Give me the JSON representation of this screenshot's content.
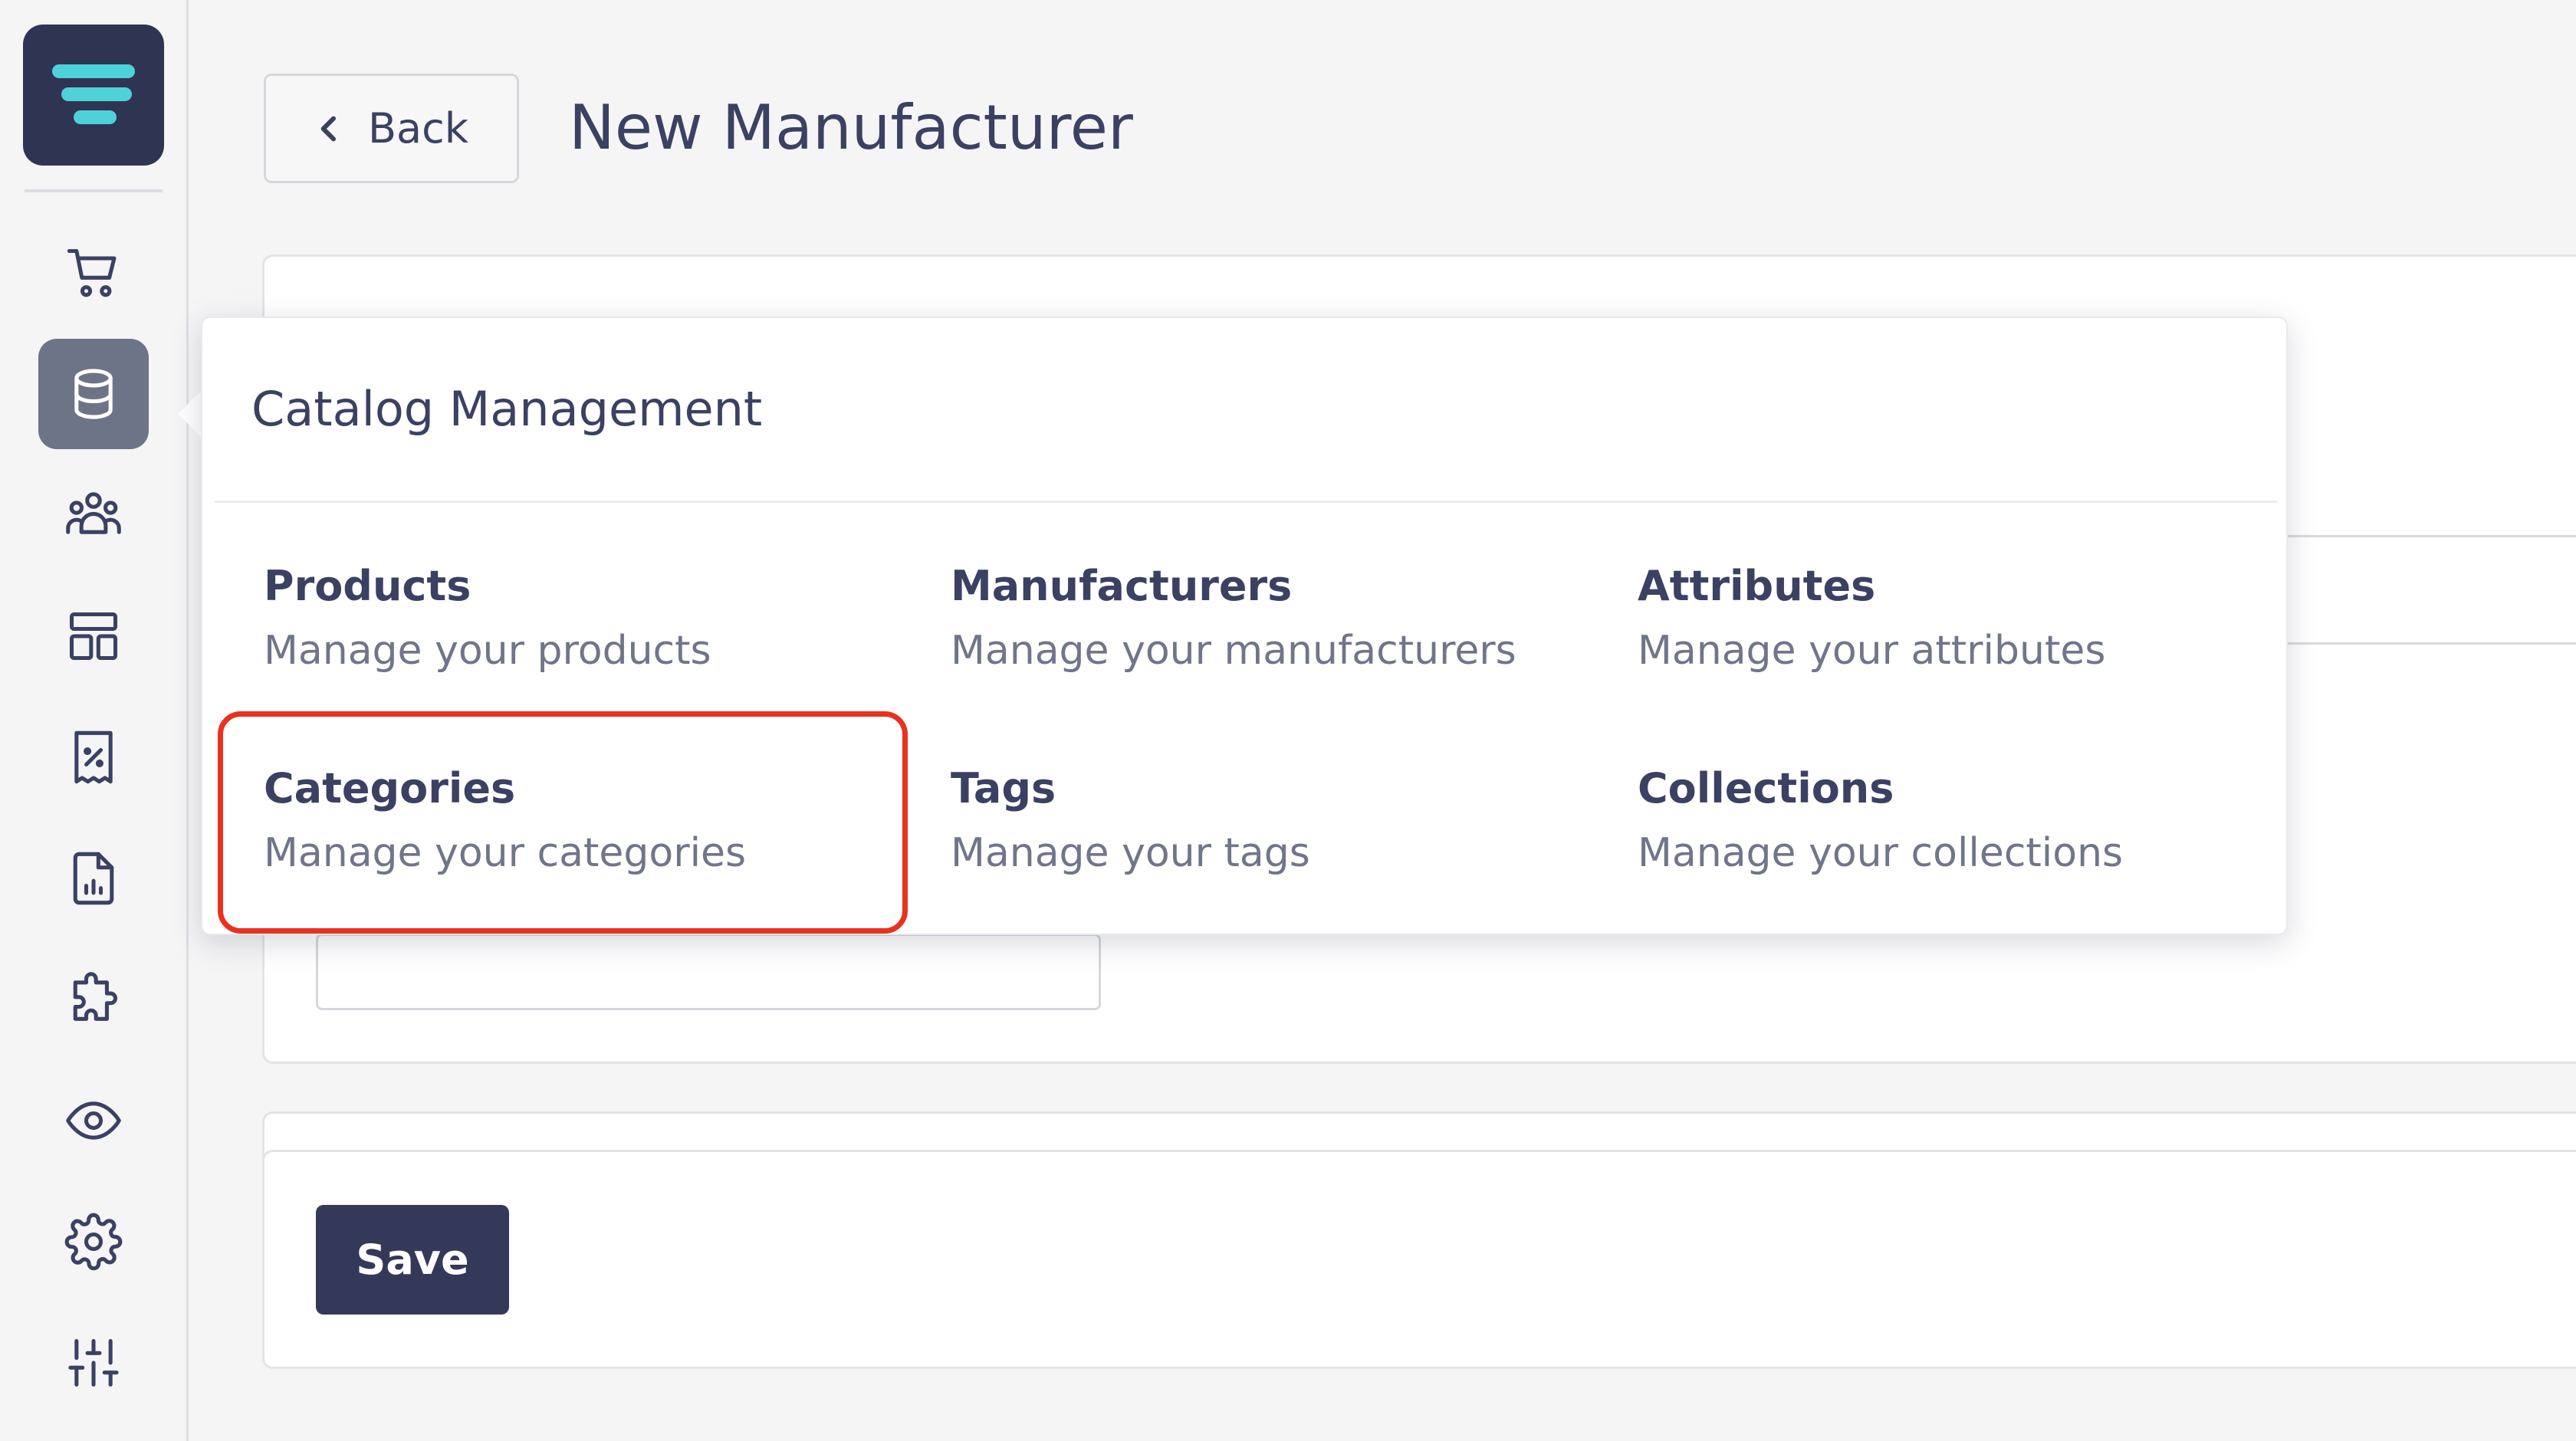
{
  "header": {
    "back_label": "Back",
    "title": "New Manufacturer"
  },
  "sidebar": {
    "items": [
      {
        "name": "cart-icon",
        "active": false
      },
      {
        "name": "database-icon",
        "active": true
      },
      {
        "name": "users-icon",
        "active": false
      },
      {
        "name": "layout-icon",
        "active": false
      },
      {
        "name": "discount-receipt-icon",
        "active": false
      },
      {
        "name": "report-icon",
        "active": false
      },
      {
        "name": "puzzle-icon",
        "active": false
      },
      {
        "name": "eye-icon",
        "active": false
      },
      {
        "name": "gear-icon",
        "active": false
      },
      {
        "name": "sliders-icon",
        "active": false
      }
    ]
  },
  "popover": {
    "title": "Catalog Management",
    "items": [
      {
        "label": "Products",
        "description": "Manage your products"
      },
      {
        "label": "Manufacturers",
        "description": "Manage your manufacturers"
      },
      {
        "label": "Attributes",
        "description": "Manage your attributes"
      },
      {
        "label": "Categories",
        "description": "Manage your categories"
      },
      {
        "label": "Tags",
        "description": "Manage your tags"
      },
      {
        "label": "Collections",
        "description": "Manage your collections"
      }
    ]
  },
  "form": {
    "save_label": "Save"
  },
  "colors": {
    "brand_dark": "#2f3453",
    "logo_accent": "#4fd1d9",
    "highlight": "#e8321e",
    "active_nav": "#6e7488"
  }
}
